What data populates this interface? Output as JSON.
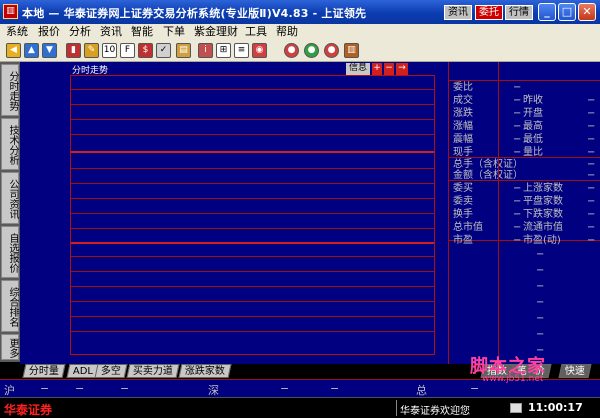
{
  "window": {
    "title": "本地 — 华泰证券网上证券交易分析系统(专业版Ⅱ)V4.83 - 上证领先",
    "icon": "chart-app-icon",
    "buttons": {
      "zixun": "资讯",
      "weituo": "委托",
      "hangqing": "行情"
    },
    "controls": {
      "minimize": "_",
      "maximize": "□",
      "close": "✕"
    }
  },
  "menu": [
    "系统",
    "报价",
    "分析",
    "资讯",
    "智能",
    "下单",
    "紫金理财",
    "工具",
    "帮助"
  ],
  "toolbar_icons": [
    "back-icon",
    "home-icon",
    "down-icon",
    "kline-icon",
    "pencil-icon",
    "f10-icon",
    "f9-icon",
    "stock-icon",
    "check-icon",
    "doc-icon",
    "info-icon",
    "calc-icon",
    "news-icon",
    "globe-icon",
    "chat-icon",
    "book-icon"
  ],
  "left_tabs": [
    "分时走势",
    "技术分析",
    "公司资讯",
    "自选报价",
    "综合排名",
    "更多"
  ],
  "chart": {
    "title": "分时走势",
    "info_btn": "信息",
    "plus": "+",
    "minus": "−",
    "right": "→"
  },
  "info_panel": {
    "rows": [
      {
        "l": "委比",
        "v": "−",
        "l2": "",
        "v2": ""
      },
      {
        "l": "成交",
        "v": "−",
        "l2": "昨收",
        "v2": "−"
      },
      {
        "l": "涨跌",
        "v": "−",
        "l2": "开盘",
        "v2": "−"
      },
      {
        "l": "涨幅",
        "v": "−",
        "l2": "最高",
        "v2": "−"
      },
      {
        "l": "震幅",
        "v": "−",
        "l2": "最低",
        "v2": "−"
      },
      {
        "l": "现手",
        "v": "−",
        "l2": "量比",
        "v2": "−"
      },
      {
        "l": "总手（含权证）",
        "v": "",
        "l2": "",
        "v2": "−"
      },
      {
        "l": "金额（含权证）",
        "v": "",
        "l2": "",
        "v2": "−"
      },
      {
        "l": "委买",
        "v": "−",
        "l2": "上涨家数",
        "v2": "−"
      },
      {
        "l": "委卖",
        "v": "−",
        "l2": "平盘家数",
        "v2": "−"
      },
      {
        "l": "换手",
        "v": "−",
        "l2": "下跌家数",
        "v2": "−"
      },
      {
        "l": "总市值",
        "v": "−",
        "l2": "流通市值",
        "v2": "−"
      },
      {
        "l": "市盈",
        "v": "−",
        "l2": "市盈(动)",
        "v2": "−"
      }
    ]
  },
  "bottom_tabs": [
    "分时量",
    "ADL",
    "多空",
    "买卖力道",
    "涨跌家数"
  ],
  "right_bottom_tabs": [
    "指数",
    "笔",
    "价",
    "分析",
    "快速"
  ],
  "status": {
    "hu": "沪",
    "shen": "深",
    "zong": "总",
    "dash": "−"
  },
  "watermark": {
    "text": "脚本之家",
    "url": "www.jb51.net"
  },
  "footer": {
    "brand": "华泰证券",
    "message": "华泰证券欢迎您",
    "time": "11:00:17"
  },
  "colors": {
    "bg": "#000080",
    "grid": "#a01010",
    "text": "#c0c0c0",
    "brand": "#ff2020"
  }
}
